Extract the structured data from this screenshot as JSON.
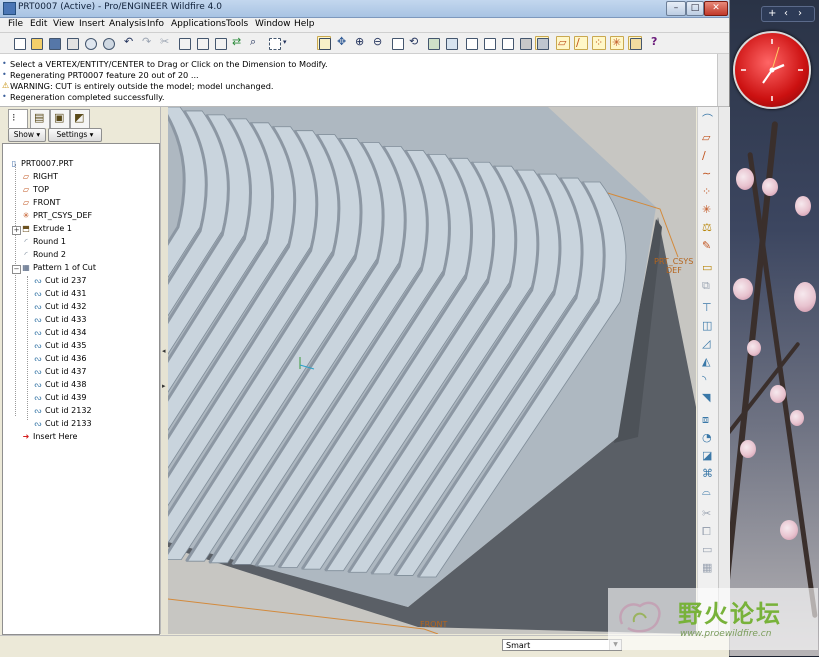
{
  "window": {
    "title": "PRT0007 (Active) - Pro/ENGINEER Wildfire 4.0",
    "buttons": {
      "minimize": "–",
      "maximize": "□",
      "close": "✕"
    }
  },
  "menu": [
    "File",
    "Edit",
    "View",
    "Insert",
    "Analysis",
    "Info",
    "Applications",
    "Tools",
    "Window",
    "Help"
  ],
  "messages": [
    {
      "symbol": "•",
      "text": "Select a VERTEX/ENTITY/CENTER to Drag or  Click on the Dimension to Modify."
    },
    {
      "symbol": "•",
      "text": "Regenerating PRT0007 feature 20 out of 20 ..."
    },
    {
      "symbol": "⚠",
      "text": "WARNING: CUT is entirely outside the model; model unchanged."
    },
    {
      "symbol": "•",
      "text": "Regeneration completed successfully."
    }
  ],
  "tree_controls": {
    "show": "Show ▾",
    "settings": "Settings ▾"
  },
  "tree": [
    {
      "label": "PRT0007.PRT",
      "level": 0,
      "icon": "part-icon"
    },
    {
      "label": "RIGHT",
      "level": 1,
      "icon": "datum-plane-icon"
    },
    {
      "label": "TOP",
      "level": 1,
      "icon": "datum-plane-icon"
    },
    {
      "label": "FRONT",
      "level": 1,
      "icon": "datum-plane-icon"
    },
    {
      "label": "PRT_CSYS_DEF",
      "level": 1,
      "icon": "csys-icon"
    },
    {
      "label": "Extrude 1",
      "level": 1,
      "icon": "extrude-icon",
      "expandable": true
    },
    {
      "label": "Round 1",
      "level": 1,
      "icon": "round-icon"
    },
    {
      "label": "Round 2",
      "level": 1,
      "icon": "round-icon"
    },
    {
      "label": "Pattern 1 of Cut",
      "level": 1,
      "icon": "pattern-icon",
      "expandable": true,
      "expanded": true
    },
    {
      "label": "Cut id 237",
      "level": 2,
      "icon": "cut-icon"
    },
    {
      "label": "Cut id 431",
      "level": 2,
      "icon": "cut-icon"
    },
    {
      "label": "Cut id 432",
      "level": 2,
      "icon": "cut-icon"
    },
    {
      "label": "Cut id 433",
      "level": 2,
      "icon": "cut-icon"
    },
    {
      "label": "Cut id 434",
      "level": 2,
      "icon": "cut-icon"
    },
    {
      "label": "Cut id 435",
      "level": 2,
      "icon": "cut-icon"
    },
    {
      "label": "Cut id 436",
      "level": 2,
      "icon": "cut-icon"
    },
    {
      "label": "Cut id 437",
      "level": 2,
      "icon": "cut-icon"
    },
    {
      "label": "Cut id 438",
      "level": 2,
      "icon": "cut-icon"
    },
    {
      "label": "Cut id 439",
      "level": 2,
      "icon": "cut-icon"
    },
    {
      "label": "Cut id 2132",
      "level": 2,
      "icon": "cut-icon"
    },
    {
      "label": "Cut id 2133",
      "level": 2,
      "icon": "cut-icon"
    },
    {
      "label": "Insert Here",
      "level": 1,
      "icon": "insert-arrow-icon"
    }
  ],
  "viewport_labels": {
    "csys": "PRT_CSYS",
    "csys2": "DEF",
    "front": "FRONT"
  },
  "status": {
    "filter": "Smart"
  },
  "watermark": {
    "cn": "野火论坛",
    "url": "www.proewildfire.cn"
  },
  "colors": {
    "part_face": "#c9d4dd",
    "model_side": "#5a5f66",
    "background": "#c7c6c2",
    "datum": "#d38a3c"
  }
}
